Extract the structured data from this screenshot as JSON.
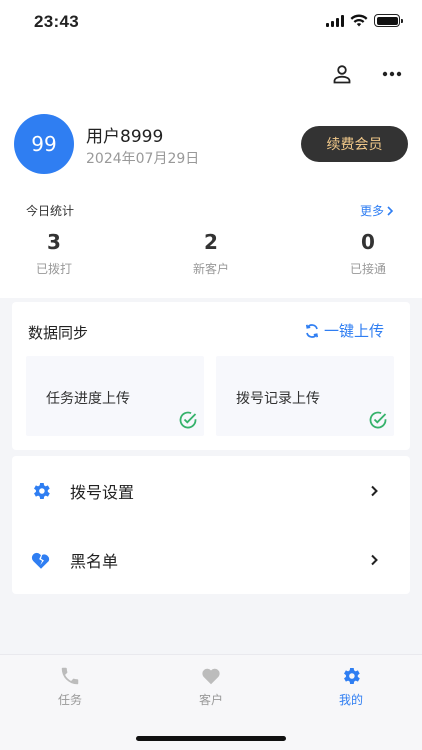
{
  "status_bar": {
    "time": "23:43"
  },
  "profile": {
    "avatar_text": "99",
    "name": "用户8999",
    "date": "2024年07月29日",
    "renew_label": "续费会员"
  },
  "today": {
    "title": "今日统计",
    "more_label": "更多",
    "stats": [
      {
        "value": "3",
        "label": "已拨打"
      },
      {
        "value": "2",
        "label": "新客户"
      },
      {
        "value": "0",
        "label": "已接通"
      }
    ]
  },
  "sync": {
    "title": "数据同步",
    "upload_all_label": "一键上传",
    "boxes": [
      {
        "label": "任务进度上传"
      },
      {
        "label": "拨号记录上传"
      }
    ]
  },
  "menu": {
    "items": [
      {
        "label": "拨号设置",
        "icon": "gear-icon"
      },
      {
        "label": "黑名单",
        "icon": "broken-heart-icon"
      }
    ]
  },
  "tabs": [
    {
      "label": "任务",
      "icon": "phone-icon",
      "active": false
    },
    {
      "label": "客户",
      "icon": "heart-icon",
      "active": false
    },
    {
      "label": "我的",
      "icon": "gear-icon",
      "active": true
    }
  ],
  "colors": {
    "accent": "#2f7ef2",
    "success": "#35b26b",
    "renew_bg": "#333333",
    "renew_text": "#f2c98a"
  }
}
